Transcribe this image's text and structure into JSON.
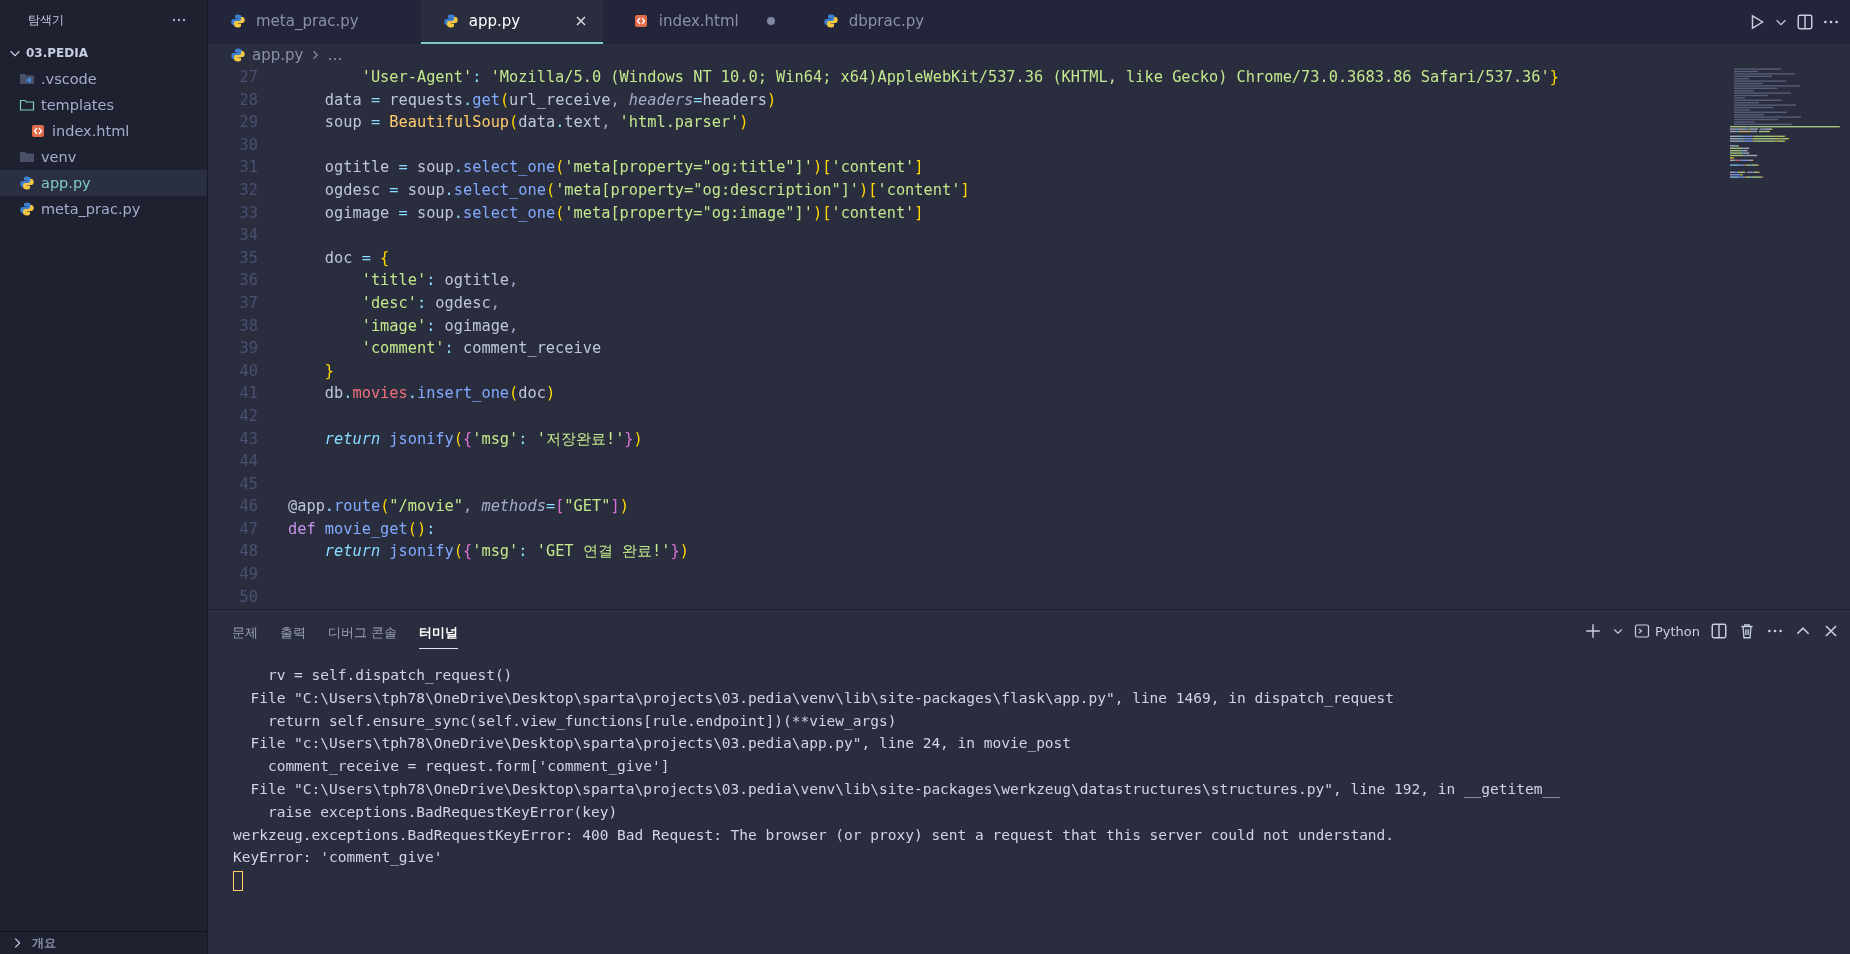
{
  "sidebar": {
    "title": "탐색기",
    "folder": {
      "name": "03.PEDIA",
      "expanded": true,
      "children": [
        {
          "name": ".vscode",
          "kind": "vscode-folder",
          "selected": false
        },
        {
          "name": "templates",
          "kind": "folder",
          "expanded": true,
          "selected": false,
          "children": [
            {
              "name": "index.html",
              "kind": "html",
              "selected": false
            }
          ]
        },
        {
          "name": "venv",
          "kind": "folder",
          "expanded": false,
          "selected": false
        },
        {
          "name": "app.py",
          "kind": "python",
          "selected": true
        },
        {
          "name": "meta_prac.py",
          "kind": "python",
          "selected": false
        }
      ]
    },
    "outline": {
      "label": "개요",
      "expanded": false
    }
  },
  "tabs": [
    {
      "label": "meta_prac.py",
      "kind": "python",
      "selected": false,
      "modified": false
    },
    {
      "label": "app.py",
      "kind": "python",
      "selected": true,
      "modified": false
    },
    {
      "label": "index.html",
      "kind": "html",
      "selected": false,
      "modified": true
    },
    {
      "label": "dbprac.py",
      "kind": "python",
      "selected": false,
      "modified": false
    }
  ],
  "breadcrumb": {
    "file": "app.py",
    "kind": "python",
    "rest": "…"
  },
  "editor": {
    "lines": [
      {
        "number": "27",
        "tokens": [
          {
            "kind": "str",
            "text": "        'User-Agent'"
          },
          {
            "kind": "op",
            "text": ": "
          },
          {
            "kind": "str",
            "text": "'Mozilla/5.0 (Windows NT 10.0; Win64; x64)AppleWebKit/537.36 (KHTML, like Gecko) Chrome/73.0.3683.86 Safari/537.36'"
          },
          {
            "kind": "br1",
            "text": "}"
          }
        ]
      },
      {
        "number": "28",
        "tokens": [
          {
            "kind": "var",
            "text": "    data"
          },
          {
            "kind": "op",
            "text": " = "
          },
          {
            "kind": "var",
            "text": "requests"
          },
          {
            "kind": "op",
            "text": "."
          },
          {
            "kind": "func",
            "text": "get"
          },
          {
            "kind": "br1",
            "text": "("
          },
          {
            "kind": "var",
            "text": "url_receive"
          },
          {
            "kind": "punct",
            "text": ", "
          },
          {
            "kind": "param",
            "text": "headers"
          },
          {
            "kind": "op",
            "text": "="
          },
          {
            "kind": "var",
            "text": "headers"
          },
          {
            "kind": "br1",
            "text": ")"
          }
        ]
      },
      {
        "number": "29",
        "tokens": [
          {
            "kind": "var",
            "text": "    soup"
          },
          {
            "kind": "op",
            "text": " = "
          },
          {
            "kind": "cls",
            "text": "BeautifulSoup"
          },
          {
            "kind": "br1",
            "text": "("
          },
          {
            "kind": "var",
            "text": "data"
          },
          {
            "kind": "op",
            "text": "."
          },
          {
            "kind": "var",
            "text": "text"
          },
          {
            "kind": "punct",
            "text": ", "
          },
          {
            "kind": "str",
            "text": "'html.parser'"
          },
          {
            "kind": "br1",
            "text": ")"
          }
        ]
      },
      {
        "number": "30"
      },
      {
        "number": "31",
        "tokens": [
          {
            "kind": "var",
            "text": "    ogtitle"
          },
          {
            "kind": "op",
            "text": " = "
          },
          {
            "kind": "var",
            "text": "soup"
          },
          {
            "kind": "op",
            "text": "."
          },
          {
            "kind": "func",
            "text": "select_one"
          },
          {
            "kind": "br1",
            "text": "("
          },
          {
            "kind": "str",
            "text": "'meta[property=\"og:title\"]'"
          },
          {
            "kind": "br1",
            "text": ")["
          },
          {
            "kind": "str",
            "text": "'content'"
          },
          {
            "kind": "br1",
            "text": "]"
          }
        ]
      },
      {
        "number": "32",
        "tokens": [
          {
            "kind": "var",
            "text": "    ogdesc"
          },
          {
            "kind": "op",
            "text": " = "
          },
          {
            "kind": "var",
            "text": "soup"
          },
          {
            "kind": "op",
            "text": "."
          },
          {
            "kind": "func",
            "text": "select_one"
          },
          {
            "kind": "br1",
            "text": "("
          },
          {
            "kind": "str",
            "text": "'meta[property=\"og:description\"]'"
          },
          {
            "kind": "br1",
            "text": ")["
          },
          {
            "kind": "str",
            "text": "'content'"
          },
          {
            "kind": "br1",
            "text": "]"
          }
        ]
      },
      {
        "number": "33",
        "tokens": [
          {
            "kind": "var",
            "text": "    ogimage"
          },
          {
            "kind": "op",
            "text": " = "
          },
          {
            "kind": "var",
            "text": "soup"
          },
          {
            "kind": "op",
            "text": "."
          },
          {
            "kind": "func",
            "text": "select_one"
          },
          {
            "kind": "br1",
            "text": "("
          },
          {
            "kind": "str",
            "text": "'meta[property=\"og:image\"]'"
          },
          {
            "kind": "br1",
            "text": ")["
          },
          {
            "kind": "str",
            "text": "'content'"
          },
          {
            "kind": "br1",
            "text": "]"
          }
        ]
      },
      {
        "number": "34"
      },
      {
        "number": "35",
        "tokens": [
          {
            "kind": "var",
            "text": "    doc"
          },
          {
            "kind": "op",
            "text": " = "
          },
          {
            "kind": "br1",
            "text": "{"
          }
        ]
      },
      {
        "number": "36",
        "tokens": [
          {
            "kind": "str",
            "text": "        'title'"
          },
          {
            "kind": "op",
            "text": ": "
          },
          {
            "kind": "var",
            "text": "ogtitle"
          },
          {
            "kind": "punct",
            "text": ","
          }
        ]
      },
      {
        "number": "37",
        "tokens": [
          {
            "kind": "str",
            "text": "        'desc'"
          },
          {
            "kind": "op",
            "text": ": "
          },
          {
            "kind": "var",
            "text": "ogdesc"
          },
          {
            "kind": "punct",
            "text": ","
          }
        ]
      },
      {
        "number": "38",
        "tokens": [
          {
            "kind": "str",
            "text": "        'image'"
          },
          {
            "kind": "op",
            "text": ": "
          },
          {
            "kind": "var",
            "text": "ogimage"
          },
          {
            "kind": "punct",
            "text": ","
          }
        ]
      },
      {
        "number": "39",
        "tokens": [
          {
            "kind": "str",
            "text": "        'comment'"
          },
          {
            "kind": "op",
            "text": ": "
          },
          {
            "kind": "var",
            "text": "comment_receive"
          }
        ]
      },
      {
        "number": "40",
        "tokens": [
          {
            "kind": "br1",
            "text": "    }"
          }
        ]
      },
      {
        "number": "41",
        "tokens": [
          {
            "kind": "var",
            "text": "    db"
          },
          {
            "kind": "op",
            "text": "."
          },
          {
            "kind": "prop",
            "text": "movies"
          },
          {
            "kind": "op",
            "text": "."
          },
          {
            "kind": "func",
            "text": "insert_one"
          },
          {
            "kind": "br1",
            "text": "("
          },
          {
            "kind": "var",
            "text": "doc"
          },
          {
            "kind": "br1",
            "text": ")"
          }
        ]
      },
      {
        "number": "42"
      },
      {
        "number": "43",
        "tokens": [
          {
            "kind": "kw",
            "text": "    return"
          },
          {
            "kind": "func",
            "text": " jsonify"
          },
          {
            "kind": "br1",
            "text": "("
          },
          {
            "kind": "br2",
            "text": "{"
          },
          {
            "kind": "str",
            "text": "'msg'"
          },
          {
            "kind": "op",
            "text": ": "
          },
          {
            "kind": "str",
            "text": "'저장완료!'"
          },
          {
            "kind": "br2",
            "text": "}"
          },
          {
            "kind": "br1",
            "text": ")"
          }
        ]
      },
      {
        "number": "44"
      },
      {
        "number": "45"
      },
      {
        "number": "46",
        "tokens": [
          {
            "kind": "var",
            "text": "@app"
          },
          {
            "kind": "op",
            "text": "."
          },
          {
            "kind": "func",
            "text": "route"
          },
          {
            "kind": "br1",
            "text": "("
          },
          {
            "kind": "str",
            "text": "\"/movie\""
          },
          {
            "kind": "punct",
            "text": ", "
          },
          {
            "kind": "param",
            "text": "methods"
          },
          {
            "kind": "op",
            "text": "="
          },
          {
            "kind": "br2",
            "text": "["
          },
          {
            "kind": "str",
            "text": "\"GET\""
          },
          {
            "kind": "br2",
            "text": "]"
          },
          {
            "kind": "br1",
            "text": ")"
          }
        ]
      },
      {
        "number": "47",
        "tokens": [
          {
            "kind": "def",
            "text": "def"
          },
          {
            "kind": "func",
            "text": " movie_get"
          },
          {
            "kind": "br1",
            "text": "()"
          },
          {
            "kind": "op",
            "text": ":"
          }
        ]
      },
      {
        "number": "48",
        "tokens": [
          {
            "kind": "kw",
            "text": "    return"
          },
          {
            "kind": "func",
            "text": " jsonify"
          },
          {
            "kind": "br1",
            "text": "("
          },
          {
            "kind": "br2",
            "text": "{"
          },
          {
            "kind": "str",
            "text": "'msg'"
          },
          {
            "kind": "op",
            "text": ": "
          },
          {
            "kind": "str",
            "text": "'GET 연결 완료!'"
          },
          {
            "kind": "br2",
            "text": "}"
          },
          {
            "kind": "br1",
            "text": ")"
          }
        ]
      },
      {
        "number": "49"
      },
      {
        "number": "50"
      }
    ]
  },
  "panel": {
    "tabs": [
      {
        "label": "문제",
        "selected": false
      },
      {
        "label": "출력",
        "selected": false
      },
      {
        "label": "디버그 콘솔",
        "selected": false
      },
      {
        "label": "터미널",
        "selected": true
      }
    ],
    "terminal_name": "Python",
    "output": [
      "    rv = self.dispatch_request()",
      "  File \"C:\\Users\\tph78\\OneDrive\\Desktop\\sparta\\projects\\03.pedia\\venv\\lib\\site-packages\\flask\\app.py\", line 1469, in dispatch_request",
      "    return self.ensure_sync(self.view_functions[rule.endpoint])(**view_args)",
      "  File \"c:\\Users\\tph78\\OneDrive\\Desktop\\sparta\\projects\\03.pedia\\app.py\", line 24, in movie_post",
      "    comment_receive = request.form['comment_give']",
      "  File \"C:\\Users\\tph78\\OneDrive\\Desktop\\sparta\\projects\\03.pedia\\venv\\lib\\site-packages\\werkzeug\\datastructures\\structures.py\", line 192, in __getitem__",
      "    raise exceptions.BadRequestKeyError(key)",
      "werkzeug.exceptions.BadRequestKeyError: 400 Bad Request: The browser (or proxy) sent a request that this server could not understand.",
      "KeyError: 'comment_give'"
    ]
  }
}
